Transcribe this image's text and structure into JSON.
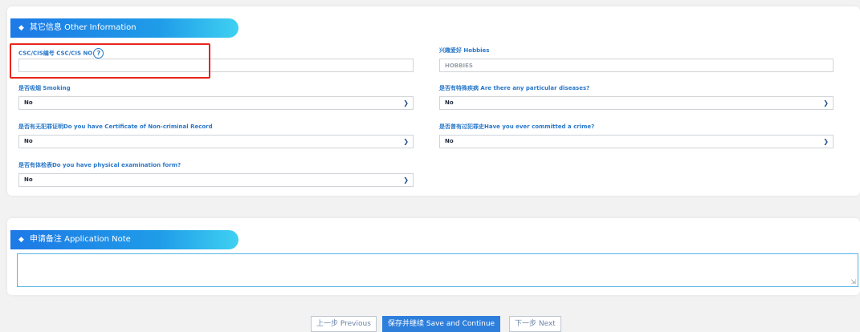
{
  "other_info": {
    "title": "其它信息 Other Information",
    "csc": {
      "label": "CSC/CIS编号 CSC/CIS NO",
      "help": "?",
      "value": ""
    },
    "hobbies": {
      "label": "兴趣爱好 Hobbies",
      "placeholder": "HOBBIES",
      "value": ""
    },
    "smoking": {
      "label": "是否吸烟 Smoking",
      "value": "No"
    },
    "diseases": {
      "label": "是否有特殊疾病 Are there any particular diseases?",
      "value": "No"
    },
    "non_criminal": {
      "label": "是否有无犯罪证明Do you have Certificate of Non-criminal Record",
      "value": "No"
    },
    "crime": {
      "label": "是否曾有过犯罪史Have you ever committed a crime?",
      "value": "No"
    },
    "physical": {
      "label": "是否有体检表Do you have physical examination form?",
      "value": "No"
    }
  },
  "application_note": {
    "title": "申请备注 Application Note",
    "value": ""
  },
  "buttons": {
    "previous": "上一步 Previous",
    "save_continue": "保存并继续 Save and Continue",
    "next": "下一步 Next"
  },
  "colors": {
    "label_blue": "#2a78c9",
    "tag_gradient_start": "#1e79e6",
    "tag_gradient_end": "#3fd0f2",
    "highlight_red": "#e8241b",
    "primary_button": "#2e7fdc"
  },
  "icons": {
    "section_marker": "diamond-icon",
    "select_arrow": "chevron-down-icon",
    "help": "help-circle-icon",
    "resize": "resize-handle-icon"
  }
}
